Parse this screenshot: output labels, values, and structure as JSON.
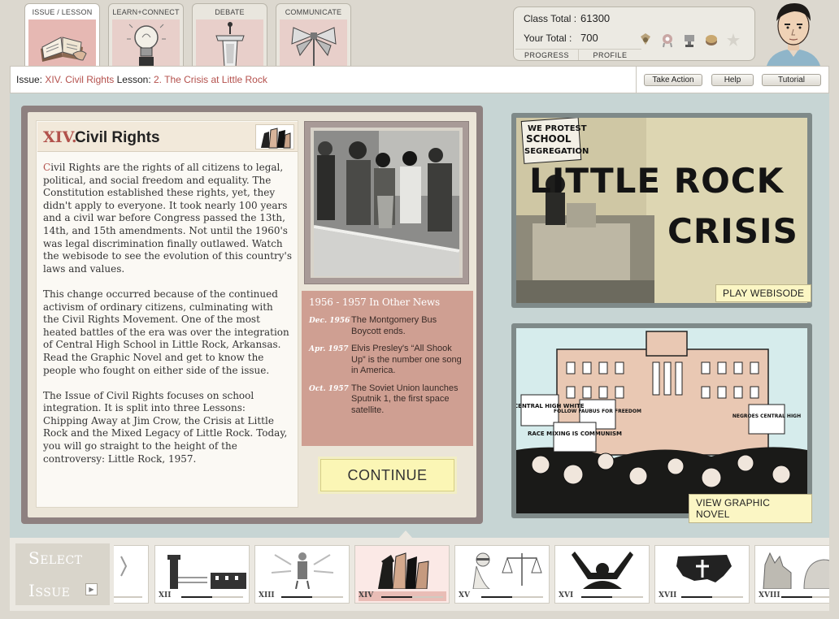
{
  "tabs": [
    {
      "label": "ISSUE / LESSON",
      "icon": "book-icon"
    },
    {
      "label": "LEARN+CONNECT",
      "icon": "lightbulb-icon"
    },
    {
      "label": "DEBATE",
      "icon": "podium-icon"
    },
    {
      "label": "COMMUNICATE",
      "icon": "megaphone-icon"
    }
  ],
  "score": {
    "class_total_label": "Class Total :",
    "class_total_value": "61300",
    "your_total_label": "Your Total :",
    "your_total_value": "700",
    "progress_label": "PROGRESS",
    "profile_label": "PROFILE",
    "badge_icons": [
      "medal-icon",
      "ribbon-icon",
      "trophy-icon",
      "coin-icon",
      "locked-star-icon"
    ]
  },
  "lesson": {
    "issue_label": "Issue:",
    "issue_value": "XIV. Civil Rights",
    "lesson_label": "Lesson:",
    "lesson_value": "2. The Crisis at Little Rock",
    "take_action": "Take Action",
    "help": "Help",
    "tutorial": "Tutorial"
  },
  "issue": {
    "roman": "XIV.",
    "title": "Civil Rights",
    "dropcap": "C",
    "p1": "ivil Rights are the rights of all citizens to legal, political, and social freedom and equality. The Constitution established these rights, yet, they didn't apply to everyone. It took nearly 100 years and a civil war before Congress passed the 13th, 14th, and 15th amendments. Not until the 1960's was legal discrimination finally outlawed. Watch the webisode to see the evolution of this country's laws and values.",
    "p2": "This change occurred because of the continued activism of ordinary citizens, culminating with the Civil Rights Movement. One of the most heated battles of the era was over the integration of Central High School in Little Rock, Arkansas. Read the Graphic Novel and get to know the people who fought on either side of the issue.",
    "p3": "The Issue of Civil Rights focuses on school integration. It is split into three Lessons: Chipping Away at Jim Crow, the Crisis at Little Rock and the Mixed Legacy of Little Rock. Today, you will go straight to the height of the controversy: Little Rock, 1957."
  },
  "news": {
    "heading": "1956 - 1957 In Other News",
    "items": [
      {
        "date": "Dec. 1956",
        "text": "The Montgomery Bus Boycott ends."
      },
      {
        "date": "Apr. 1957",
        "text": "Elvis Presley's “All Shook Up” is the number one song in America."
      },
      {
        "date": "Oct. 1957",
        "text": "The Soviet Union launches Sputnik 1, the first space satellite."
      }
    ]
  },
  "continue_label": "CONTINUE",
  "webisode": {
    "sign_line1": "WE PROTEST",
    "sign_line2": "SCHOOL",
    "sign_line3": "SEGREGATION",
    "title_line1": "LITTLE ROCK",
    "title_line2": "CRISIS",
    "button": "PLAY WEBISODE"
  },
  "novel": {
    "signs": [
      "KEEP CENTRAL HIGH WHITE",
      "FOLLOW FAUBUS FOR FREEDOM",
      "RACE MIXING IS COMMUNISM",
      "NEGROES CENTRAL HIGH"
    ],
    "button": "VIEW GRAPHIC NOVEL"
  },
  "strip": {
    "select_line1": "Select",
    "select_line2": "Issue",
    "thumbs": [
      {
        "num": "",
        "icon": "partial-issue-icon",
        "progress": 0.5
      },
      {
        "num": "XII",
        "icon": "prison-icon",
        "progress": 0.5
      },
      {
        "num": "XIII",
        "icon": "person-arrows-icon",
        "progress": 0.5
      },
      {
        "num": "XIV",
        "icon": "raised-fists-icon",
        "progress": 0.5
      },
      {
        "num": "XV",
        "icon": "justice-scales-icon",
        "progress": 0.5
      },
      {
        "num": "XVI",
        "icon": "raised-arms-icon",
        "progress": 0.5
      },
      {
        "num": "XVII",
        "icon": "us-map-cross-icon",
        "progress": 0.5
      },
      {
        "num": "XVIII",
        "icon": "donkey-elephant-icon",
        "progress": 0.5
      }
    ]
  }
}
